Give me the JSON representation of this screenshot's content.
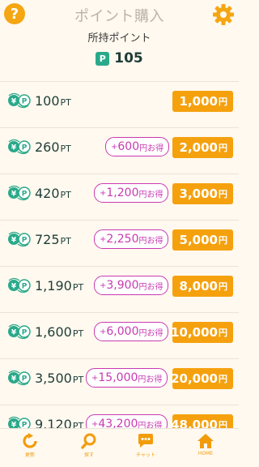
{
  "header": {
    "title": "ポイント購入",
    "help_icon_text": "?"
  },
  "balance": {
    "label": "所持ポイント",
    "badge": "P",
    "value": "105"
  },
  "colors": {
    "accent_orange": "#f5a10e",
    "bonus_magenta": "#c93ab1",
    "teal": "#2aa98a",
    "background": "#fff9ef"
  },
  "packages": [
    {
      "points": "100",
      "unit": "PT",
      "bonus": null,
      "price": "1,000",
      "price_unit": "円"
    },
    {
      "points": "260",
      "unit": "PT",
      "bonus": {
        "prefix": "+",
        "amount": "600",
        "suffix": "円お得"
      },
      "price": "2,000",
      "price_unit": "円"
    },
    {
      "points": "420",
      "unit": "PT",
      "bonus": {
        "prefix": "+",
        "amount": "1,200",
        "suffix": "円お得"
      },
      "price": "3,000",
      "price_unit": "円"
    },
    {
      "points": "725",
      "unit": "PT",
      "bonus": {
        "prefix": "+",
        "amount": "2,250",
        "suffix": "円お得"
      },
      "price": "5,000",
      "price_unit": "円"
    },
    {
      "points": "1,190",
      "unit": "PT",
      "bonus": {
        "prefix": "+",
        "amount": "3,900",
        "suffix": "円お得"
      },
      "price": "8,000",
      "price_unit": "円"
    },
    {
      "points": "1,600",
      "unit": "PT",
      "bonus": {
        "prefix": "+",
        "amount": "6,000",
        "suffix": "円お得"
      },
      "price": "10,000",
      "price_unit": "円"
    },
    {
      "points": "3,500",
      "unit": "PT",
      "bonus": {
        "prefix": "+",
        "amount": "15,000",
        "suffix": "円お得"
      },
      "price": "20,000",
      "price_unit": "円"
    },
    {
      "points": "9,120",
      "unit": "PT",
      "bonus": {
        "prefix": "+",
        "amount": "43,200",
        "suffix": "円お得"
      },
      "price": "48,000",
      "price_unit": "円"
    }
  ],
  "nav": {
    "items": [
      {
        "label": "更新",
        "icon": "refresh-icon"
      },
      {
        "label": "探す",
        "icon": "search-icon"
      },
      {
        "label": "チャット",
        "icon": "chat-icon"
      },
      {
        "label": "HOME",
        "icon": "home-icon"
      }
    ]
  }
}
